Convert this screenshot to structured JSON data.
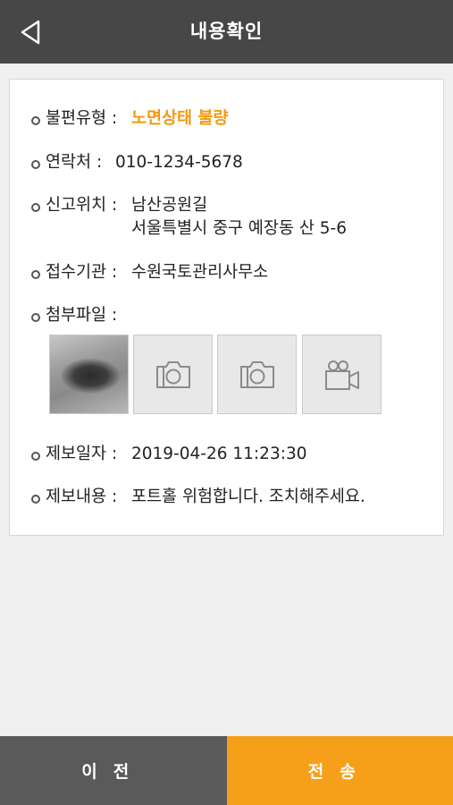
{
  "header": {
    "title": "내용확인"
  },
  "details": {
    "type_label": "불편유형 :",
    "type_value": "노면상태 불량",
    "contact_label": "연락처 :",
    "contact_value": "010-1234-5678",
    "location_label": "신고위치 :",
    "location_line1": "남산공원길",
    "location_line2": "서울특별시 중구 예장동 산 5-6",
    "agency_label": "접수기관 :",
    "agency_value": "수원국토관리사무소",
    "attach_label": "첨부파일 :",
    "date_label": "제보일자 :",
    "date_value": "2019-04-26 11:23:30",
    "content_label": "제보내용 :",
    "content_value": "포트홀 위험합니다. 조치해주세요."
  },
  "attachments": [
    "photo-thumbnail",
    "camera-icon",
    "camera-icon",
    "video-camera-icon"
  ],
  "footer": {
    "prev_label": "이전",
    "send_label": "전송"
  },
  "colors": {
    "header": "#474747",
    "accent": "#f5a018",
    "prev_button": "#5a5a5a"
  }
}
